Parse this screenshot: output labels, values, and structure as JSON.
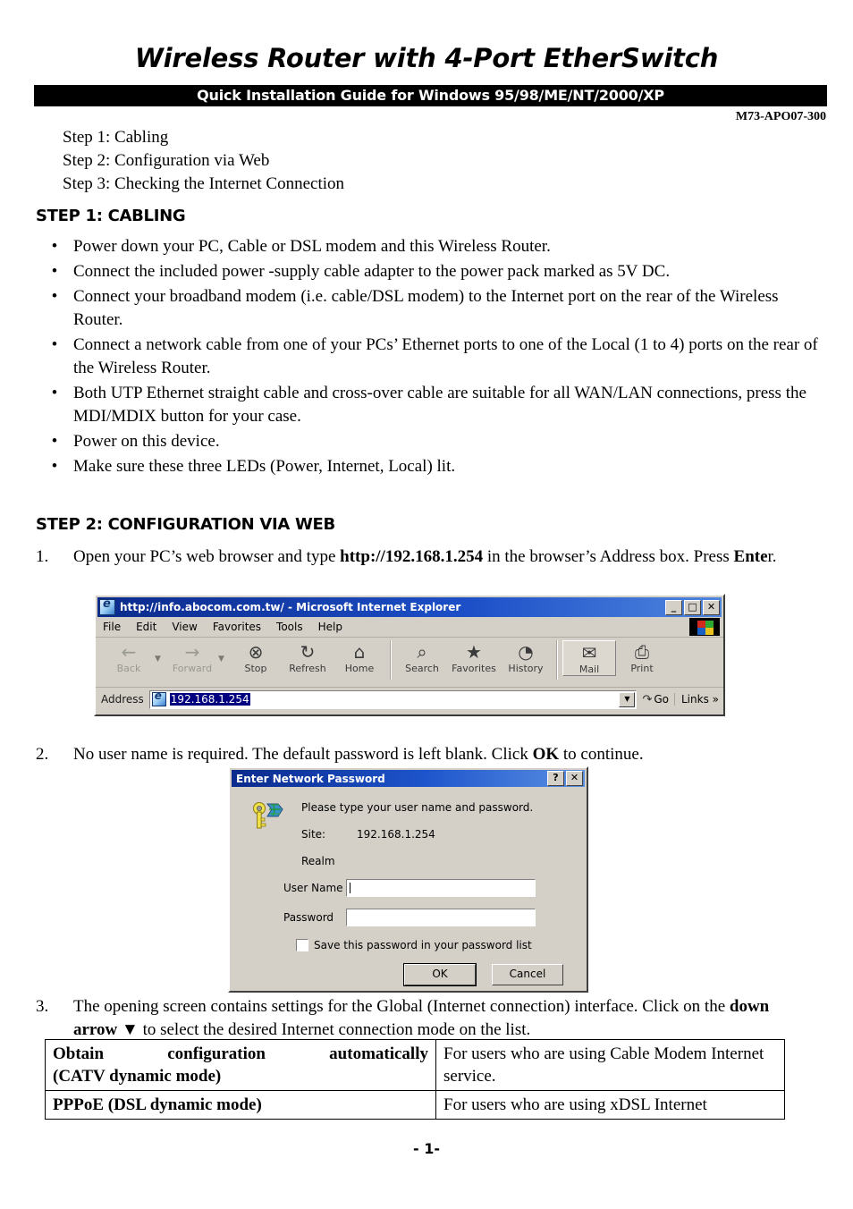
{
  "header": {
    "title": "Wireless Router with 4-Port EtherSwitch",
    "banner": "Quick Installation Guide for Windows 95/98/ME/NT/2000/XP",
    "model_no": "M73-APO07-300"
  },
  "overview_steps": [
    "Step 1: Cabling",
    "Step 2: Configuration via Web",
    "Step 3: Checking the Internet Connection"
  ],
  "step1": {
    "heading": "STEP 1: CABLING",
    "bullet_mark": "•",
    "bullets": [
      "Power down your PC, Cable or DSL modem and this Wireless Router.",
      "Connect the included power -supply cable adapter to the power pack marked as 5V DC.",
      "Connect your broadband modem (i.e. cable/DSL modem) to the Internet port on the rear of the Wireless Router.",
      "Connect a network cable from one of your PCs’ Ethernet ports to one of the Local (1 to 4) ports on the rear of the Wireless Router.",
      "Both UTP Ethernet straight cable and cross-over cable are suitable for all WAN/LAN connections, press the MDI/MDIX button for your case.",
      "Power on this device.",
      "Make sure these three LEDs (Power, Internet, Local) lit."
    ]
  },
  "step2": {
    "heading": "STEP 2:  CONFIGURATION VIA WEB",
    "item1": {
      "number": "1.",
      "part1": "Open your PC’s web browser and type ",
      "bold1": "http://192.168.1.254",
      "part2": " in the browser’s Address box. Press ",
      "bold2": "Ente",
      "part3": "r."
    },
    "item2": {
      "number": "2.",
      "part1": "No user name is required. The default password  is left blank. Click ",
      "bold1": "OK",
      "part2": " to continue."
    },
    "item3": {
      "number": "3.",
      "part1": "The opening screen contains settings for the Global (Internet connection) interface. Click on the ",
      "bold1": "down arrow",
      "arrow": "▼",
      "part2": " to select the desired Internet connection mode on the list."
    }
  },
  "browser": {
    "title": "http://info.abocom.com.tw/ - Microsoft Internet Explorer",
    "window_buttons": [
      "_",
      "□",
      "✕"
    ],
    "menus": [
      "File",
      "Edit",
      "View",
      "Favorites",
      "Tools",
      "Help"
    ],
    "toolbar": [
      {
        "label": "Back",
        "icon": "back-arrow-icon",
        "glyph": "←",
        "dim": true,
        "dropdown": true
      },
      {
        "label": "Forward",
        "icon": "forward-arrow-icon",
        "glyph": "→",
        "dim": true,
        "dropdown": true
      },
      {
        "label": "Stop",
        "icon": "stop-icon",
        "glyph": "⊗",
        "dim": false,
        "dropdown": false
      },
      {
        "label": "Refresh",
        "icon": "refresh-icon",
        "glyph": "↻",
        "dim": false,
        "dropdown": false
      },
      {
        "label": "Home",
        "icon": "home-icon",
        "glyph": "⌂",
        "dim": false,
        "dropdown": false
      },
      {
        "label": "Search",
        "icon": "search-icon",
        "glyph": "⌕",
        "dim": false,
        "dropdown": false
      },
      {
        "label": "Favorites",
        "icon": "favorites-folder-icon",
        "glyph": "★",
        "dim": false,
        "dropdown": false
      },
      {
        "label": "History",
        "icon": "history-clock-icon",
        "glyph": "◔",
        "dim": false,
        "dropdown": false
      },
      {
        "label": "Mail",
        "icon": "mail-icon",
        "glyph": "✉",
        "dim": false,
        "dropdown": true
      },
      {
        "label": "Print",
        "icon": "printer-icon",
        "glyph": "⎙",
        "dim": false,
        "dropdown": false
      }
    ],
    "address_label": "Address",
    "address_value": "192.168.1.254",
    "go_label": "Go",
    "links_label": "Links",
    "links_chevron": "»",
    "dropdown_glyph": "▼"
  },
  "password_dialog": {
    "title": "Enter Network Password",
    "help_button": "?",
    "close_button": "✕",
    "prompt": "Please type your user name and password.",
    "site_label": "Site:",
    "site_value": "192.168.1.254",
    "realm_label": "Realm",
    "username_label": "User Name",
    "username_value": "",
    "password_label": "Password",
    "password_value": "",
    "save_checkbox_label": "Save this password in your password list",
    "ok_label": "OK",
    "cancel_label": "Cancel"
  },
  "mode_table": {
    "rows": [
      {
        "mode": "Obtain configuration automatically",
        "mode_line2": "(CATV dynamic mode)",
        "description": "For users who are using Cable Modem Internet service."
      },
      {
        "mode": "PPPoE (DSL dynamic mode)",
        "mode_line2": "",
        "description": "For users who are using xDSL Internet"
      }
    ]
  },
  "footer": {
    "page_number": "- 1-"
  }
}
